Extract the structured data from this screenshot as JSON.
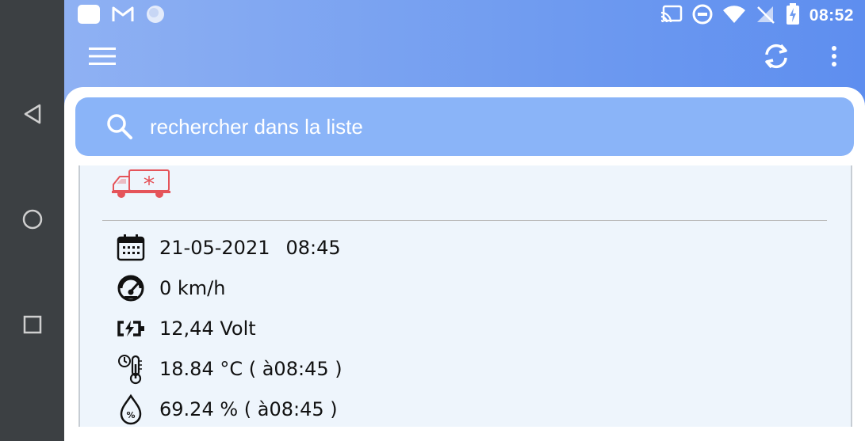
{
  "status_bar": {
    "time": "08:52",
    "left_icons": [
      "square-icon",
      "gmail-icon",
      "circle-app-icon"
    ],
    "right_icons": [
      "cast-icon",
      "do-not-disturb-icon",
      "wifi-icon",
      "no-signal-icon",
      "battery-charging-icon"
    ]
  },
  "toolbar": {
    "menu_icon": "hamburger-icon",
    "refresh_icon": "refresh-icon",
    "overflow_icon": "more-vert-icon"
  },
  "search": {
    "placeholder": "rechercher dans la liste"
  },
  "vehicle": {
    "icon": "refrigerated-truck-icon",
    "icon_color": "#e5545a",
    "date": "21-05-2021",
    "time": "08:45",
    "speed": "0 km/h",
    "voltage": "12,44 Volt",
    "temperature": "18.84 °C ( à08:45 )",
    "humidity": "69.24 % ( à08:45 )"
  },
  "colors": {
    "accent": "#8ab4f8",
    "appbar": "#6f9bf0",
    "card_bg": "#eef5fc",
    "nav_rail": "#3c4043"
  },
  "system_nav": [
    "back-icon",
    "home-icon",
    "recents-icon"
  ]
}
